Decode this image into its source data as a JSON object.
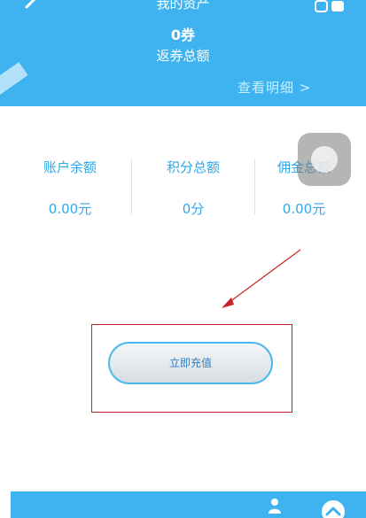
{
  "header": {
    "title": "我的资产",
    "coupon_value": "0券",
    "coupon_label": "返券总额",
    "detail_link": "查看明细 >"
  },
  "stats": [
    {
      "label": "账户余额",
      "value": "0.00元"
    },
    {
      "label": "积分总额",
      "value": "0分"
    },
    {
      "label": "佣金总额",
      "value": "0.00元"
    }
  ],
  "recharge_button": "立即充值",
  "colors": {
    "header_bg": "#3fb3ef",
    "accent_text": "#2fa8e8",
    "highlight_border": "#c8242b",
    "arrow": "#c8242b"
  },
  "icons": {
    "back": "back-arrow-icon",
    "menu": "menu-icon",
    "floating": "assistive-touch-icon",
    "user": "user-icon",
    "scroll_top": "chevron-up-icon"
  }
}
